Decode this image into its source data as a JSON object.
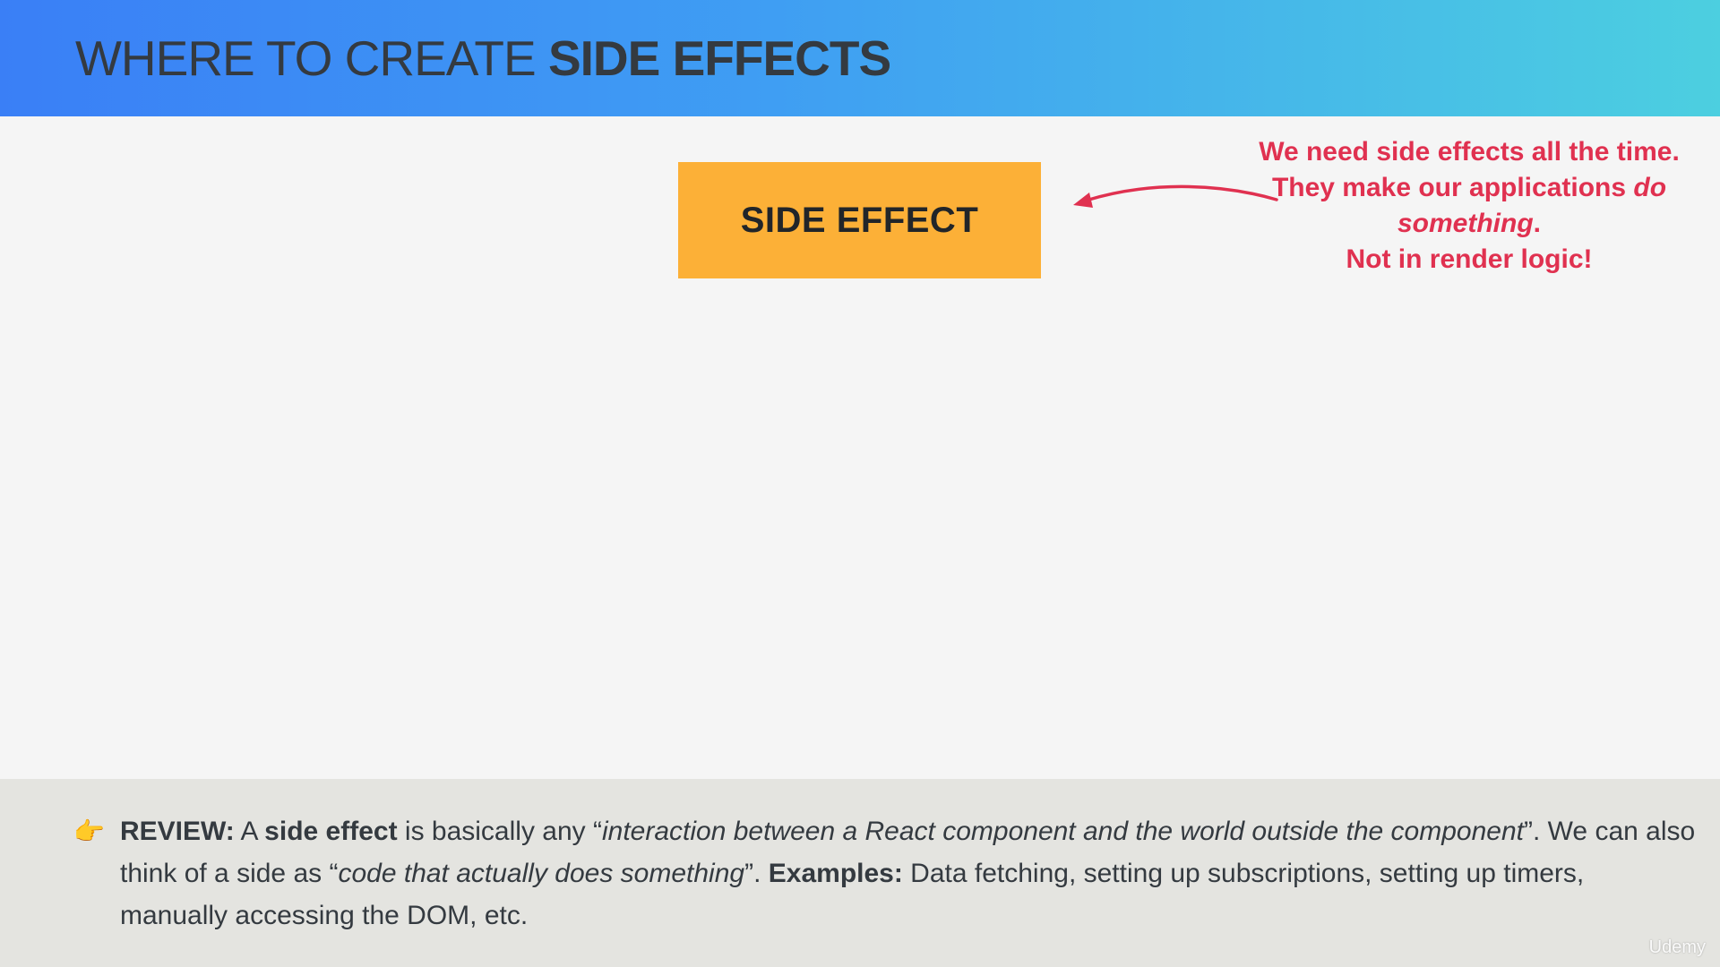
{
  "header": {
    "title_light": "WHERE TO CREATE ",
    "title_bold": "SIDE EFFECTS",
    "gradient": [
      "#3a7ff6",
      "#4ccfe0"
    ]
  },
  "box": {
    "label": "SIDE EFFECT",
    "color": "#fcb037"
  },
  "note": {
    "line1": "We need side effects all the time. They make our applications ",
    "italic": "do something",
    "period": ".",
    "not": "Not",
    "rest": " in render logic!",
    "color": "#e03150"
  },
  "review": {
    "icon": "pointing-hand-icon",
    "label": "REVIEW:",
    "t1": " A ",
    "bold1": "side effect",
    "t2": " is basically any “",
    "ital1": "interaction between a React component and the world outside the component",
    "t3": "”. We can also think of a side as “",
    "ital2": "code that actually does something",
    "t4": "”. ",
    "bold2": "Examples:",
    "t5": " Data fetching, setting up subscriptions, setting up timers, manually accessing the DOM, etc."
  },
  "watermark": "Udemy"
}
